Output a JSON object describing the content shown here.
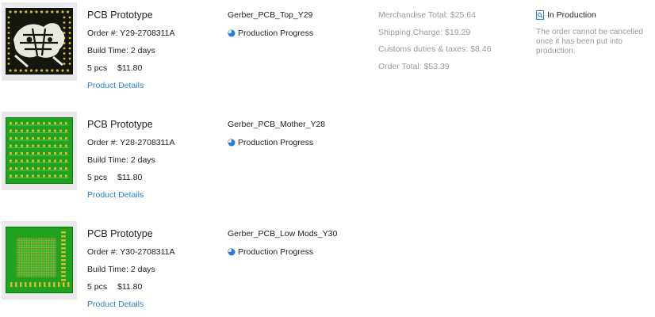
{
  "colors": {
    "link": "#2a7fd4",
    "muted": "#9a9a9a",
    "text": "#222222",
    "pcb_black": "#14170f",
    "pcb_green": "#1fa21f",
    "pcb_gold": "#d8b830"
  },
  "orders": [
    {
      "board_style": "black-silkscreen",
      "title": "PCB Prototype",
      "order_no": "Order #: Y29-2708311A",
      "build_time": "Build Time: 2 days",
      "qty": "5 pcs",
      "price": "$11.80",
      "details_link": "Product Details",
      "gerber": "Gerber_PCB_Top_Y29",
      "progress_label": "Production Progress",
      "progress_icon": "pie-progress-icon"
    },
    {
      "board_style": "green-array",
      "title": "PCB Prototype",
      "order_no": "Order #: Y28-2708311A",
      "build_time": "Build Time: 2 days",
      "qty": "5 pcs",
      "price": "$11.80",
      "details_link": "Product Details",
      "gerber": "Gerber_PCB_Mother_Y28",
      "progress_label": "Production Progress",
      "progress_icon": "pie-progress-icon"
    },
    {
      "board_style": "green-grid",
      "title": "PCB Prototype",
      "order_no": "Order #: Y30-2708311A",
      "build_time": "Build Time: 2 days",
      "qty": "5 pcs",
      "price": "$11.80",
      "details_link": "Product Details",
      "gerber": "Gerber_PCB_Low Mods_Y30",
      "progress_label": "Production Progress",
      "progress_icon": "pie-progress-icon"
    }
  ],
  "summary": {
    "merchandise_total": "Merchandise Total: $25.64",
    "shipping_charge": "Shipping Charge: $19.29",
    "customs": "Customs duties & taxes: $8.46",
    "order_total": "Order Total: $53.39"
  },
  "status": {
    "icon": "search-document-icon",
    "label": "In Production",
    "note": "The order cannot be cancelled once it has been put into production."
  }
}
